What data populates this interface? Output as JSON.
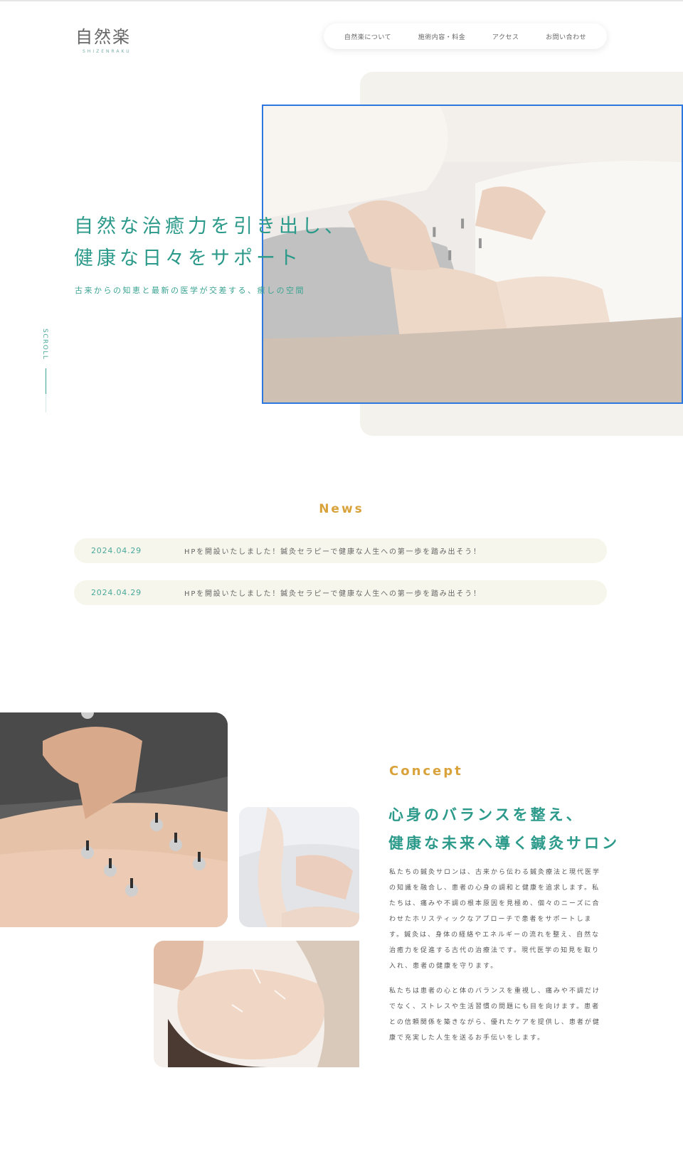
{
  "header": {
    "logo_text": "自然楽",
    "logo_sub": "SHIZENRAKU",
    "nav": [
      "自然楽について",
      "施術内容・料金",
      "アクセス",
      "お問い合わせ"
    ]
  },
  "hero": {
    "title_line1": "自然な治癒力を引き出し、",
    "title_line2": "健康な日々をサポート",
    "subtitle": "古来からの知恵と最新の医学が交差する、癒しの空間",
    "scroll": "SCROLL"
  },
  "news": {
    "heading": "News",
    "items": [
      {
        "date": "2024.04.29",
        "text": "HPを開設いたしました！鍼灸セラピーで健康な人生への第一歩を踏み出そう！"
      },
      {
        "date": "2024.04.29",
        "text": "HPを開設いたしました！鍼灸セラピーで健康な人生への第一歩を踏み出そう！"
      }
    ]
  },
  "concept": {
    "heading": "Concept",
    "title_line1": "心身のバランスを整え、",
    "title_line2": "健康な未来へ導く鍼灸サロン",
    "paragraph1": "私たちの鍼灸サロンは、古来から伝わる鍼灸療法と現代医学の知識を融合し、患者の心身の調和と健康を追求します。私たちは、痛みや不調の根本原因を見極め、個々のニーズに合わせたホリスティックなアプローチで患者をサポートします。鍼灸は、身体の経絡やエネルギーの流れを整え、自然な治癒力を促進する古代の治療法です。現代医学の知見を取り入れ、患者の健康を守ります。",
    "paragraph2": "私たちは患者の心と体のバランスを重視し、痛みや不調だけでなく、ストレスや生活習慣の問題にも目を向けます。患者との信頼関係を築きながら、優れたケアを提供し、患者が健康で充実した人生を送るお手伝いをします。"
  },
  "colors": {
    "accent_teal": "#2c9a8a",
    "accent_gold": "#d9a23a",
    "news_bg": "#f7f6ec",
    "hero_bg": "#f3f2ec"
  }
}
